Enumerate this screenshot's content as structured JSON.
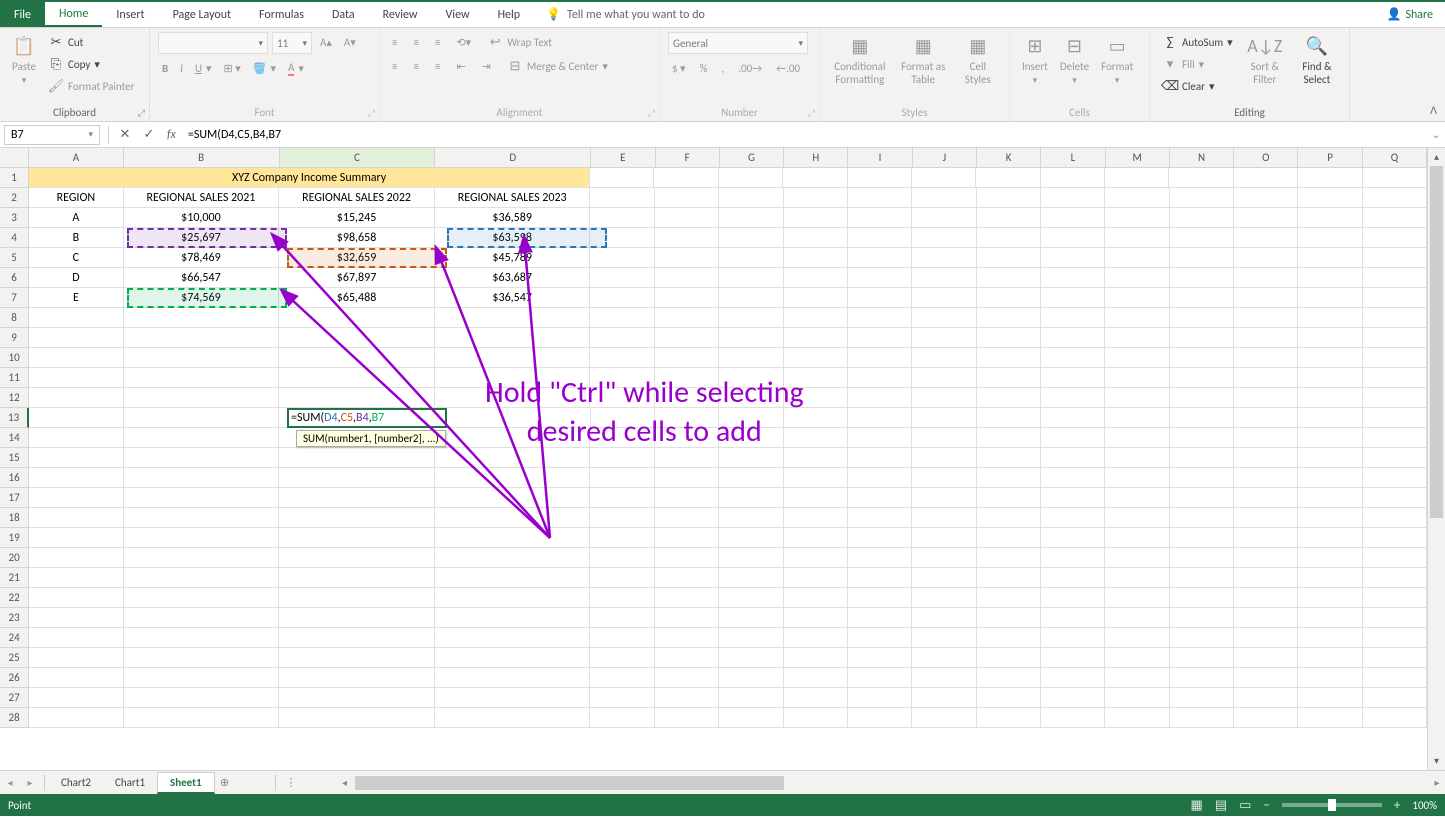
{
  "tabs": {
    "file": "File",
    "home": "Home",
    "insert": "Insert",
    "page_layout": "Page Layout",
    "formulas": "Formulas",
    "data": "Data",
    "review": "Review",
    "view": "View",
    "help": "Help",
    "tell_me": "Tell me what you want to do",
    "share": "Share"
  },
  "ribbon": {
    "clipboard": {
      "label": "Clipboard",
      "paste": "Paste",
      "cut": "Cut",
      "copy": "Copy",
      "format_painter": "Format Painter"
    },
    "font": {
      "label": "Font",
      "font_name": "",
      "font_size": "11"
    },
    "alignment": {
      "label": "Alignment",
      "wrap": "Wrap Text",
      "merge": "Merge & Center"
    },
    "number": {
      "label": "Number",
      "format": "General"
    },
    "styles": {
      "label": "Styles",
      "cond": "Conditional Formatting",
      "table": "Format as Table",
      "cell": "Cell Styles"
    },
    "cells": {
      "label": "Cells",
      "insert": "Insert",
      "delete": "Delete",
      "format": "Format"
    },
    "editing": {
      "label": "Editing",
      "autosum": "AutoSum",
      "fill": "Fill",
      "clear": "Clear",
      "sort": "Sort & Filter",
      "find": "Find & Select"
    }
  },
  "formula_bar": {
    "name_box": "B7",
    "formula": "=SUM(D4,C5,B4,B7"
  },
  "columns": [
    "A",
    "B",
    "C",
    "D",
    "E",
    "F",
    "G",
    "H",
    "I",
    "J",
    "K",
    "L",
    "M",
    "N",
    "O",
    "P",
    "Q"
  ],
  "col_widths": {
    "A": 97,
    "B": 160,
    "C": 160,
    "D": 160,
    "default": 66
  },
  "row_count": 28,
  "data": {
    "title": "XYZ Company Income Summary",
    "headers": [
      "REGION",
      "REGIONAL SALES 2021",
      "REGIONAL SALES 2022",
      "REGIONAL SALES 2023"
    ],
    "rows": [
      [
        "A",
        "$10,000",
        "$15,245",
        "$36,589"
      ],
      [
        "B",
        "$25,697",
        "$98,658",
        "$63,598"
      ],
      [
        "C",
        "$78,469",
        "$32,659",
        "$45,789"
      ],
      [
        "D",
        "$66,547",
        "$67,897",
        "$63,687"
      ],
      [
        "E",
        "$74,569",
        "$65,488",
        "$36,547"
      ]
    ]
  },
  "formula_cell": {
    "text_parts": {
      "eq": "=SUM(",
      "d4": "D4",
      "c5": "C5",
      "b4": "B4",
      "b7": "B7"
    },
    "tooltip": "SUM(number1, [number2], ...)"
  },
  "annotation": {
    "line1": "Hold \"Ctrl\" while selecting",
    "line2": "desired cells to add"
  },
  "sheet_tabs": {
    "chart2": "Chart2",
    "chart1": "Chart1",
    "sheet1": "Sheet1"
  },
  "status": {
    "mode": "Point",
    "zoom": "100%"
  }
}
